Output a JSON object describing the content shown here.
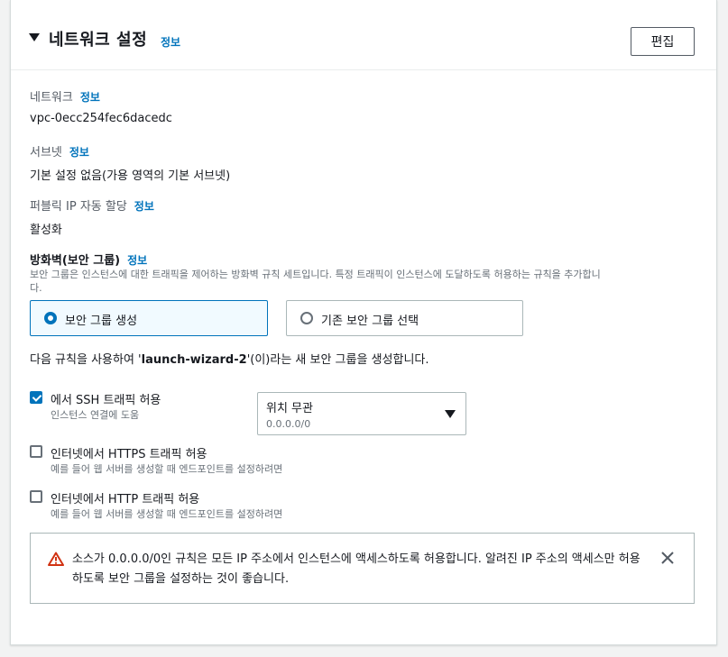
{
  "section": {
    "title": "네트워크 설정",
    "info": "정보",
    "edit_label": "편집"
  },
  "network": {
    "label": "네트워크",
    "info": "정보",
    "value": "vpc-0ecc254fec6dacedc"
  },
  "subnet": {
    "label": "서브넷",
    "info": "정보",
    "value": "기본 설정 없음(가용 영역의 기본 서브넷)"
  },
  "public_ip": {
    "label": "퍼블릭 IP 자동 할당",
    "info": "정보",
    "value": "활성화"
  },
  "firewall": {
    "label": "방화벽(보안 그룹)",
    "info": "정보",
    "description_line1": "보안 그룹은 인스턴스에 대한 트래픽을 제어하는 방화벽 규칙 세트입니다. 특정 트래픽이 인스턴스에 도달하도록 허용하는 규칙을 추가합니",
    "description_line2": "다.",
    "options": [
      {
        "label": "보안 그룹 생성",
        "selected": true
      },
      {
        "label": "기존 보안 그룹 선택",
        "selected": false
      }
    ],
    "note_prefix": "다음 규칙을 사용하여 '",
    "note_name": "launch-wizard-2",
    "note_suffix": "'(이)라는 새 보안 그룹을 생성합니다."
  },
  "rules": [
    {
      "label": "에서 SSH 트래픽 허용",
      "sub": "인스턴스 연결에 도움",
      "checked": true
    },
    {
      "label": "인터넷에서 HTTPS 트래픽 허용",
      "sub": "예를 들어 웹 서버를 생성할 때 엔드포인트를 설정하려면",
      "checked": false
    },
    {
      "label": "인터넷에서 HTTP 트래픽 허용",
      "sub": "예를 들어 웹 서버를 생성할 때 엔드포인트를 설정하려면",
      "checked": false
    }
  ],
  "source_select": {
    "value": "위치 무관",
    "sub": "0.0.0.0/0"
  },
  "alert": {
    "text": "소스가 0.0.0.0/0인 규칙은 모든 IP 주소에서 인스턴스에 액세스하도록 허용합니다. 알려진 IP 주소의 액세스만 허용하도록 보안 그룹을 설정하는 것이 좋습니다."
  },
  "colors": {
    "accent": "#0073bb",
    "warning": "#d13212",
    "border": "#aab7b8"
  }
}
